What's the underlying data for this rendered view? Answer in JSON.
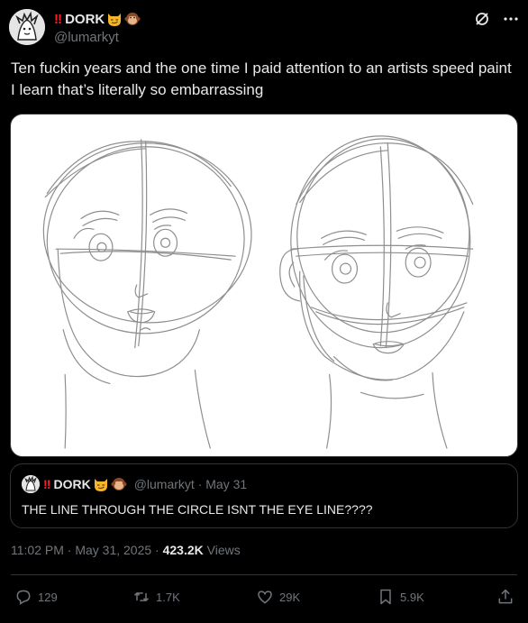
{
  "author": {
    "bang": "‼",
    "name": "DORK",
    "emoji1": "smirking-cat",
    "emoji2": "monkey",
    "handle": "@lumarkyt"
  },
  "header_icons": [
    "grok-icon",
    "more-icon"
  ],
  "tweet": {
    "text": "Ten fuckin years and the one time I paid attention to an artists speed paint I learn that’s literally so embarrassing"
  },
  "quote": {
    "bang": "‼",
    "name": "DORK",
    "meta": "@lumarkyt · May 31",
    "text": "THE LINE THROUGH THE CIRCLE ISNT THE EYE LINE????"
  },
  "timestamp": {
    "time": "11:02 PM · May 31, 2025 · ",
    "views_count": "423.2K",
    "views_label": " Views"
  },
  "actions": {
    "reply": "129",
    "retweet": "1.7K",
    "like": "29K",
    "bookmark": "5.9K"
  },
  "colors": {
    "background": "#000000",
    "text": "#e7e9ea",
    "muted": "#71767b",
    "border": "#2f3336",
    "bang": "#f4212e"
  }
}
